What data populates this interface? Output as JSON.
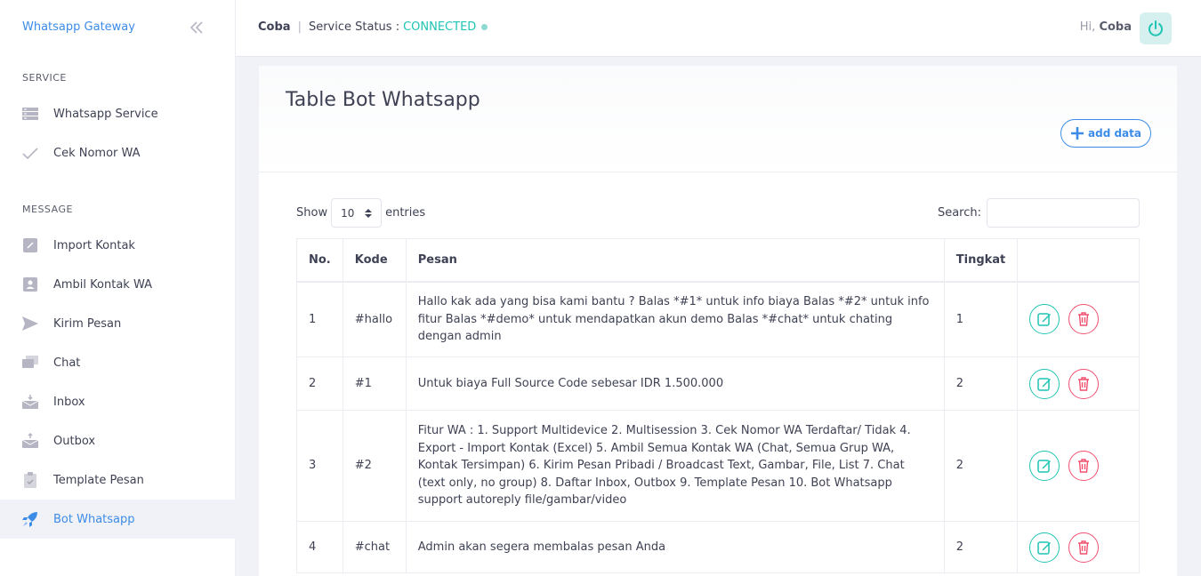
{
  "sidebar": {
    "brand": "Whatsapp Gateway",
    "sections": [
      {
        "title": "SERVICE"
      },
      {
        "title": "MESSAGE"
      }
    ],
    "items": [
      {
        "label": "Whatsapp Service",
        "icon": "server-icon"
      },
      {
        "label": "Cek Nomor WA",
        "icon": "check-icon"
      },
      {
        "label": "Import Kontak",
        "icon": "phone-book-icon"
      },
      {
        "label": "Ambil Kontak WA",
        "icon": "contact-card-icon"
      },
      {
        "label": "Kirim Pesan",
        "icon": "send-icon"
      },
      {
        "label": "Chat",
        "icon": "chat-icon"
      },
      {
        "label": "Inbox",
        "icon": "inbox-icon"
      },
      {
        "label": "Outbox",
        "icon": "outbox-icon"
      },
      {
        "label": "Template Pesan",
        "icon": "clipboard-icon"
      },
      {
        "label": "Bot Whatsapp",
        "icon": "rocket-icon"
      }
    ]
  },
  "header": {
    "user": "Coba",
    "separator": "|",
    "status_label": "Service Status :",
    "status_value": "CONNECTED",
    "greet_hi": "Hi,",
    "greet_name": "Coba"
  },
  "card": {
    "title": "Table Bot Whatsapp",
    "add_label": "add data"
  },
  "table_controls": {
    "show_label": "Show",
    "entries_value": "10",
    "entries_label": "entries",
    "search_label": "Search:"
  },
  "table": {
    "columns": [
      "No.",
      "Kode",
      "Pesan",
      "Tingkat",
      ""
    ],
    "rows": [
      {
        "no": "1",
        "kode": "#hallo",
        "pesan": "Hallo kak ada yang bisa kami bantu ? Balas *#1* untuk info biaya Balas *#2* untuk info fitur Balas *#demo* untuk mendapatkan akun demo Balas *#chat* untuk chating dengan admin",
        "tingkat": "1"
      },
      {
        "no": "2",
        "kode": "#1",
        "pesan": "Untuk biaya Full Source Code sebesar IDR 1.500.000",
        "tingkat": "2"
      },
      {
        "no": "3",
        "kode": "#2",
        "pesan": "Fitur WA : 1. Support Multidevice 2. Multisession 3. Cek Nomor WA Terdaftar/ Tidak 4. Export - Import Kontak (Excel) 5. Ambil Semua Kontak WA (Chat, Semua Grup WA, Kontak Tersimpan) 6. Kirim Pesan Pribadi / Broadcast Text, Gambar, File, List 7. Chat (text only, no group) 8. Daftar Inbox, Outbox 9. Template Pesan 10. Bot Whatsapp support autoreply file/gambar/video",
        "tingkat": "2"
      },
      {
        "no": "4",
        "kode": "#chat",
        "pesan": "Admin akan segera membalas pesan Anda",
        "tingkat": "2"
      }
    ]
  },
  "colors": {
    "accent": "#3c8ce7",
    "success": "#1fc4b4",
    "danger": "#f0506e"
  }
}
